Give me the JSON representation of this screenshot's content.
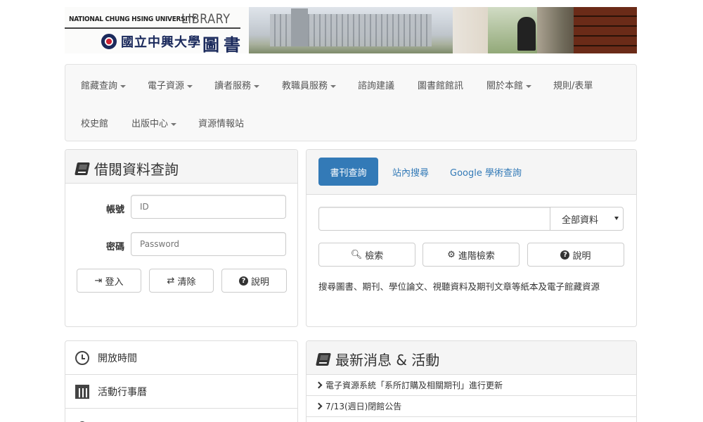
{
  "banner": {
    "en_name": "NATIONAL CHUNG HSING UNIVERSITY",
    "library_word": "LIBRARY",
    "cn_university": "國立中興大學",
    "cn_library": "圖書館"
  },
  "nav": {
    "items": [
      {
        "label": "館藏查詢",
        "dropdown": true
      },
      {
        "label": "電子資源",
        "dropdown": true
      },
      {
        "label": "讀者服務",
        "dropdown": true
      },
      {
        "label": "教職員服務",
        "dropdown": true
      },
      {
        "label": "諮詢建議",
        "dropdown": false
      },
      {
        "label": "圖書館館訊",
        "dropdown": false
      },
      {
        "label": "關於本館",
        "dropdown": true
      },
      {
        "label": "規則/表單",
        "dropdown": false
      },
      {
        "label": "校史館",
        "dropdown": false
      },
      {
        "label": "出版中心",
        "dropdown": true
      },
      {
        "label": "資源情報站",
        "dropdown": false
      }
    ]
  },
  "login": {
    "title": "借閱資料查詢",
    "account_label": "帳號",
    "account_placeholder": "ID",
    "password_label": "密碼",
    "password_placeholder": "Password",
    "login_button": "登入",
    "clear_button": "清除",
    "help_button": "說明"
  },
  "search": {
    "tabs": [
      "書刊查詢",
      "站內搜尋",
      "Google 學術查詢"
    ],
    "active_tab": 0,
    "query_value": "",
    "scope_selected": "全部資料",
    "search_button": "檢索",
    "advanced_button": "進階檢索",
    "help_button": "說明",
    "description": "搜尋圖書、期刊、學位論文、視聽資料及期刊文章等紙本及電子館藏資源"
  },
  "quick_links": {
    "items": [
      {
        "label": "開放時間",
        "icon": "clock-icon"
      },
      {
        "label": "活動行事曆",
        "icon": "calendar-icon"
      },
      {
        "label": "",
        "icon": "person-icon"
      }
    ]
  },
  "news": {
    "title": "最新消息 & 活動",
    "items": [
      "電子資源系統「系所訂購及相關期刊」進行更新",
      "7/13(週日)閉館公告"
    ]
  },
  "colors": {
    "accent": "#337ab7",
    "nav_bg": "#f8f8f8",
    "panel_heading_bg": "#f5f5f5"
  }
}
